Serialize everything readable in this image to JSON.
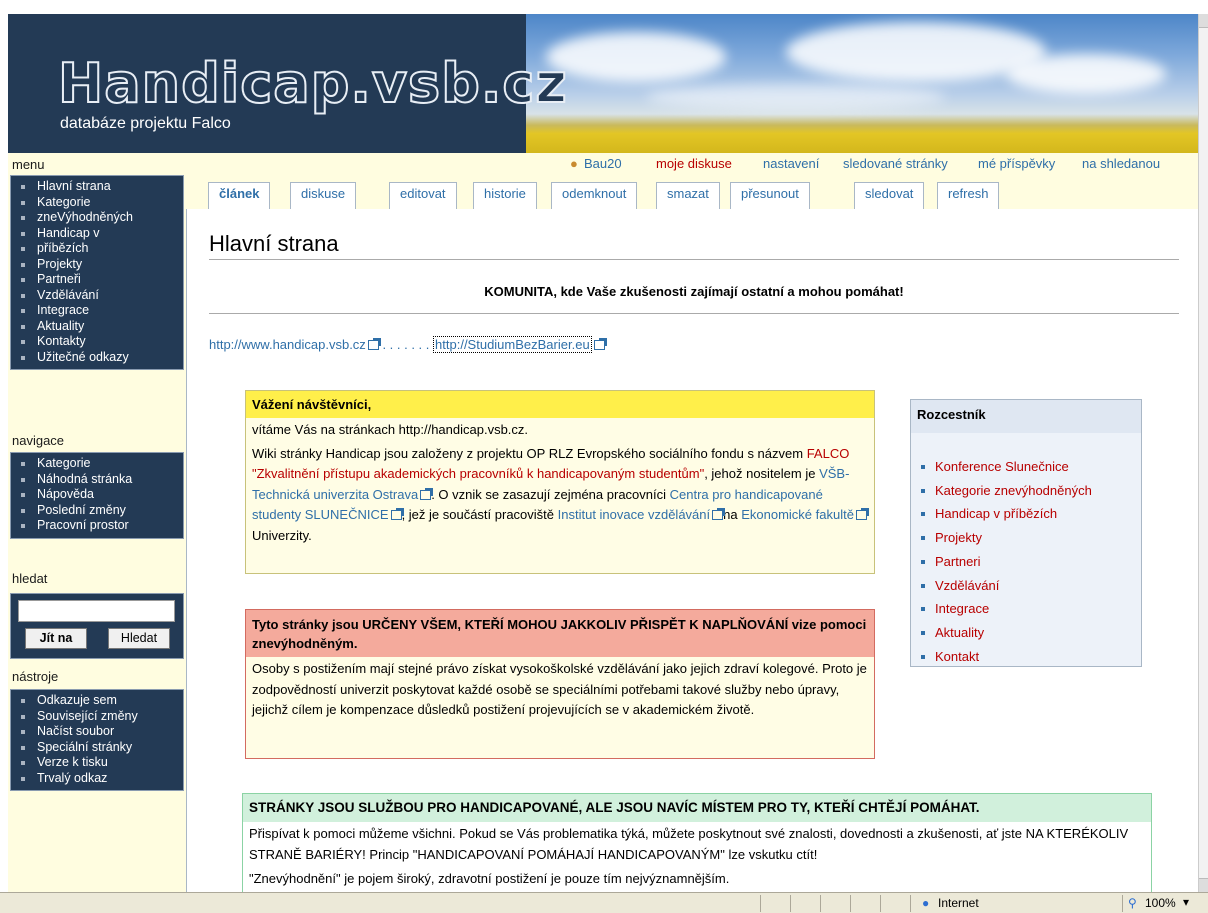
{
  "header": {
    "logo": "Handicap.vsb.cz",
    "tagline": "databáze projektu Falco"
  },
  "menu": {
    "title": "menu",
    "items": [
      "Hlavní strana",
      "Kategorie",
      "zneVýhodněných",
      "Handicap v",
      "příbězích",
      "Projekty",
      "Partneři",
      "Vzdělávání",
      "Integrace",
      "Aktuality",
      "Kontakty",
      "Užitečné odkazy"
    ]
  },
  "navigace": {
    "title": "navigace",
    "items": [
      "Kategorie",
      "Náhodná stránka",
      "Nápověda",
      "Poslední změny",
      "Pracovní prostor"
    ]
  },
  "hledat": {
    "title": "hledat",
    "go": "Jít na",
    "search": "Hledat"
  },
  "nastroje": {
    "title": "nástroje",
    "items": [
      "Odkazuje sem",
      "Související změny",
      "Načíst soubor",
      "Speciální stránky",
      "Verze k tisku",
      "Trvalý odkaz"
    ]
  },
  "userbar": {
    "user": "Bau20",
    "my_discussion": "moje diskuse",
    "settings": "nastavení",
    "watched": "sledované stránky",
    "contribs": "mé příspěvky",
    "logout": "na shledanou"
  },
  "tabs": [
    "článek",
    "diskuse",
    "editovat",
    "historie",
    "odemknout",
    "smazat",
    "přesunout",
    "sledovat",
    "refresh"
  ],
  "page": {
    "title": "Hlavní strana",
    "tagline": "KOMUNITA, kde Vaše zkušenosti zajímají ostatní a mohou pomáhat!",
    "link1": "http://www.handicap.vsb.cz",
    "dots": ". . . . . . .",
    "link2": "http://StudiumBezBarier.eu"
  },
  "box1": {
    "header": "Vážení návštěvníci,",
    "line1": "vítáme Vás na stránkach http://handicap.vsb.cz.",
    "p1a": "Wiki stránky Handicap jsou založeny z projektu OP RLZ Evropského sociálního fondu s názvem ",
    "p1b": "FALCO \"Zkvalitnění přístupu akademických pracovníků k handicapovaným studentům\"",
    "p1c": ", jehož nositelem je ",
    "p1d": "VŠB-Technická univerzita Ostrava",
    "p1e": ". O vznik se zasazují zejména pracovníci ",
    "p1f": "Centra pro handicapované studenty SLUNEČNICE",
    "p1g": ", jež je součástí pracoviště ",
    "p1h": "Institut inovace vzdělávání",
    "p1i": "na ",
    "p1j": "Ekonomické fakultě",
    "p1k": " Univerzity."
  },
  "box2": {
    "header": "Tyto stránky jsou URČENY VŠEM, KTEŘÍ MOHOU JAKKOLIV PŘISPĚT K NAPLŇOVÁNÍ vize pomoci znevýhodněným.",
    "body": "Osoby s postižením mají stejné právo získat vysokoškolské vzdělávání jako jejich zdraví kolegové. Proto je zodpovědností univerzit poskytovat každé osobě se speciálními potřebami takové služby nebo úpravy, jejichž cílem je kompenzace důsledků postižení projevujících se v akademickém životě."
  },
  "box3": {
    "header": "STRÁNKY JSOU SLUŽBOU PRO HANDICAPOVANÉ, ALE JSOU NAVÍC MÍSTEM PRO TY, KTEŘÍ CHTĚJÍ POMÁHAT.",
    "body1": "Přispívat k pomoci můžeme všichni. Pokud se Vás problematika týká, můžete poskytnout své znalosti, dovednosti a zkušenosti, ať jste NA KTERÉKOLIV STRANĚ BARIÉRY! Princip \"HANDICAPOVANÍ POMÁHAJÍ HANDICAPOVANÝM\" lze vskutku ctít!",
    "body2": "\"Znevýhodnění\" je pojem široký, zdravotní postižení je pouze tím nejvýznamnějším."
  },
  "rozcestnik": {
    "title": "Rozcestník",
    "items": [
      "Konference Slunečnice",
      "Kategorie znevýhodněných",
      "Handicap v příbězích",
      "Projekty",
      "Partneri",
      "Vzdělávání",
      "Integrace",
      "Aktuality",
      "Kontakt"
    ]
  },
  "statusbar": {
    "zone": "Internet",
    "zoom": "100%"
  },
  "colors": {
    "header_bg": "#233a55",
    "sidebar_bg": "#fffde0",
    "link": "#2f6fa8",
    "new_link": "#b80000"
  }
}
